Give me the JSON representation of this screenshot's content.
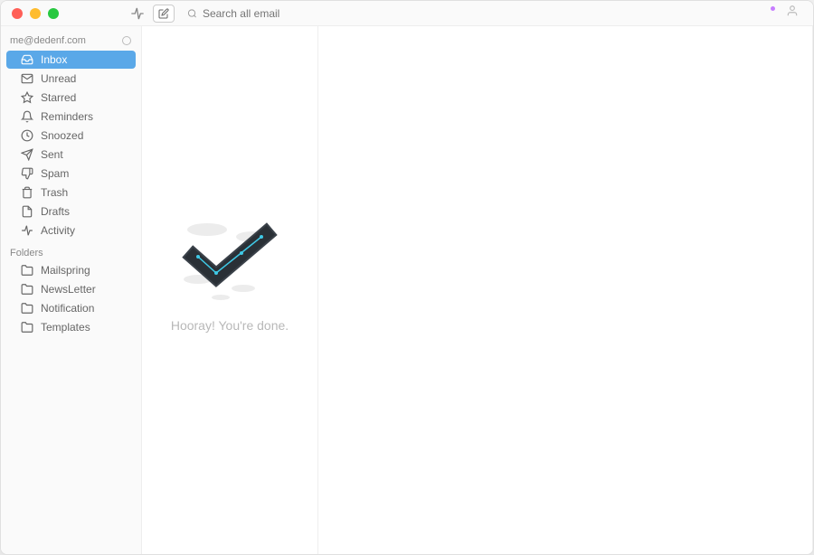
{
  "account": {
    "email": "me@dedenf.com"
  },
  "search": {
    "placeholder": "Search all email"
  },
  "nav": {
    "items": [
      {
        "id": "inbox",
        "label": "Inbox",
        "icon": "inbox",
        "selected": true
      },
      {
        "id": "unread",
        "label": "Unread",
        "icon": "mail",
        "selected": false
      },
      {
        "id": "starred",
        "label": "Starred",
        "icon": "star",
        "selected": false
      },
      {
        "id": "reminders",
        "label": "Reminders",
        "icon": "bell",
        "selected": false
      },
      {
        "id": "snoozed",
        "label": "Snoozed",
        "icon": "clock",
        "selected": false
      },
      {
        "id": "sent",
        "label": "Sent",
        "icon": "send",
        "selected": false
      },
      {
        "id": "spam",
        "label": "Spam",
        "icon": "thumbdown",
        "selected": false
      },
      {
        "id": "trash",
        "label": "Trash",
        "icon": "trash",
        "selected": false
      },
      {
        "id": "drafts",
        "label": "Drafts",
        "icon": "file",
        "selected": false
      },
      {
        "id": "activity",
        "label": "Activity",
        "icon": "pulse",
        "selected": false
      }
    ]
  },
  "folders": {
    "header": "Folders",
    "items": [
      {
        "id": "mailspring",
        "label": "Mailspring"
      },
      {
        "id": "newsletter",
        "label": "NewsLetter"
      },
      {
        "id": "notification",
        "label": "Notification"
      },
      {
        "id": "templates",
        "label": "Templates"
      }
    ]
  },
  "emptyState": {
    "message": "Hooray! You're done."
  }
}
